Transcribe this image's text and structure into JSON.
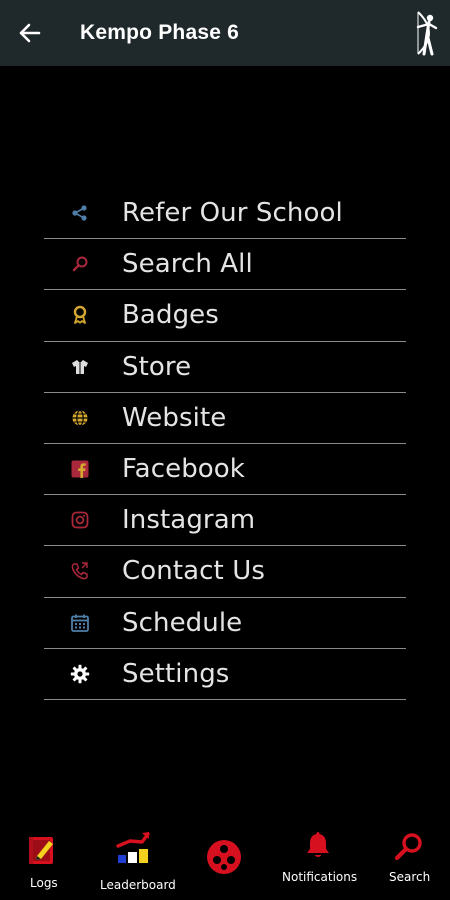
{
  "appbar": {
    "title": "Kempo Phase 6",
    "back_icon": "arrow-left-icon",
    "logo_icon": "archer-icon"
  },
  "menu": {
    "items": [
      {
        "label": "Refer Our School",
        "icon": "share-icon",
        "color": "#4f7fa8"
      },
      {
        "label": "Search All",
        "icon": "search-icon",
        "color": "#a8283c"
      },
      {
        "label": "Badges",
        "icon": "badge-icon",
        "color": "#d4a82e"
      },
      {
        "label": "Store",
        "icon": "uniform-icon",
        "color": "#dddddd"
      },
      {
        "label": "Website",
        "icon": "globe-icon",
        "color": "#d4a82e"
      },
      {
        "label": "Facebook",
        "icon": "facebook-icon",
        "color": "#a8283c"
      },
      {
        "label": "Instagram",
        "icon": "instagram-icon",
        "color": "#a8283c"
      },
      {
        "label": "Contact Us",
        "icon": "phone-icon",
        "color": "#a8283c"
      },
      {
        "label": "Schedule",
        "icon": "calendar-icon",
        "color": "#4f7fa8"
      },
      {
        "label": "Settings",
        "icon": "gear-icon",
        "color": "#ffffff"
      }
    ]
  },
  "bottom_nav": {
    "logs": "Logs",
    "leaderboard": "Leaderboard",
    "home_icon": "dots-circle-icon",
    "notifications": "Notifications",
    "search": "Search"
  },
  "colors": {
    "appbar_bg": "#1f282b",
    "background": "#000000",
    "accent_red": "#d6101f"
  }
}
